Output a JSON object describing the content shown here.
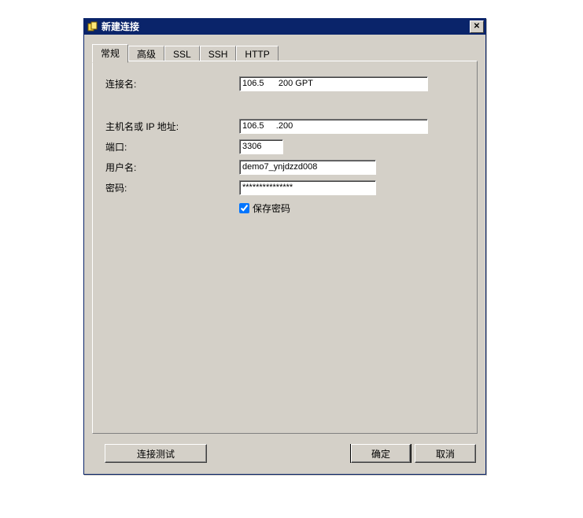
{
  "window": {
    "title": "新建连接"
  },
  "tabs": [
    {
      "label": "常规",
      "active": true
    },
    {
      "label": "高级",
      "active": false
    },
    {
      "label": "SSL",
      "active": false
    },
    {
      "label": "SSH",
      "active": false
    },
    {
      "label": "HTTP",
      "active": false
    }
  ],
  "form": {
    "connection_name_label": "连接名:",
    "connection_name_value": "106.5      200 GPT",
    "host_label": "主机名或 IP 地址:",
    "host_value": "106.5     .200",
    "port_label": "端口:",
    "port_value": "3306",
    "user_label": "用户名:",
    "user_value": "demo7_ynjdzzd008",
    "password_label": "密码:",
    "password_value": "***************",
    "save_password_label": "保存密码",
    "save_password_checked": true
  },
  "buttons": {
    "test": "连接测试",
    "ok": "确定",
    "cancel": "取消"
  }
}
